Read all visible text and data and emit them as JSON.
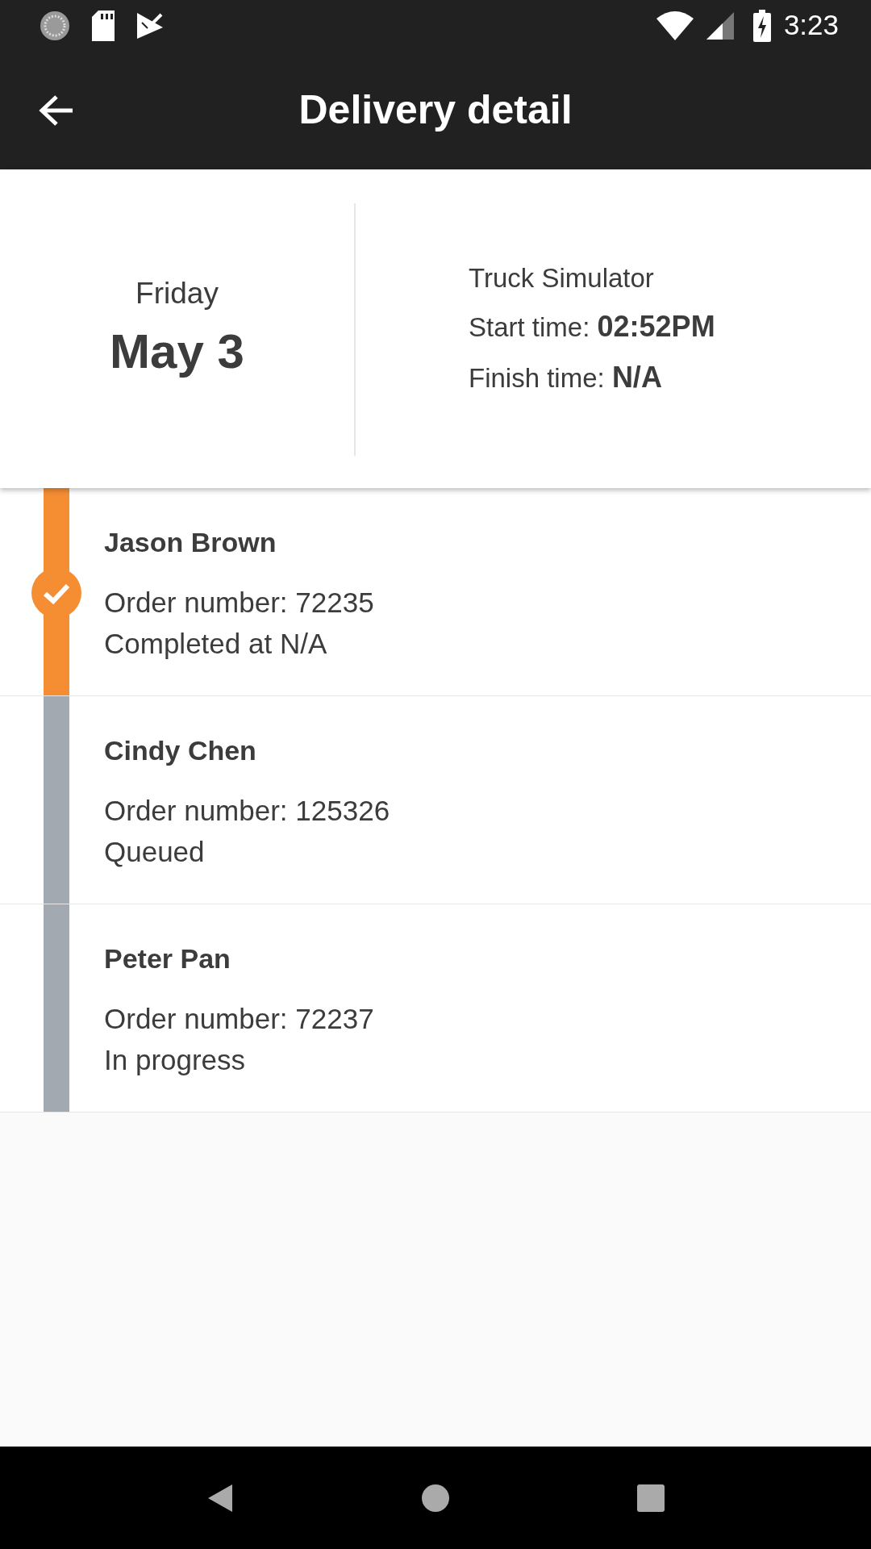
{
  "status_bar": {
    "time": "3:23"
  },
  "app_bar": {
    "title": "Delivery detail"
  },
  "summary": {
    "day": "Friday",
    "date": "May 3",
    "vehicle": "Truck Simulator",
    "start": "Start time: **02:52PM**",
    "finish": "Finish time: **N/A**"
  },
  "deliveries": [
    {
      "customer": "Jason Brown",
      "order": "Order number: 72235",
      "status": "Completed at N/A",
      "completed": true
    },
    {
      "customer": "Cindy Chen",
      "order": "Order number: 125326",
      "status": "Queued",
      "completed": false
    },
    {
      "customer": "Peter Pan",
      "order": "Order number: 72237",
      "status": "In progress",
      "completed": false
    }
  ]
}
